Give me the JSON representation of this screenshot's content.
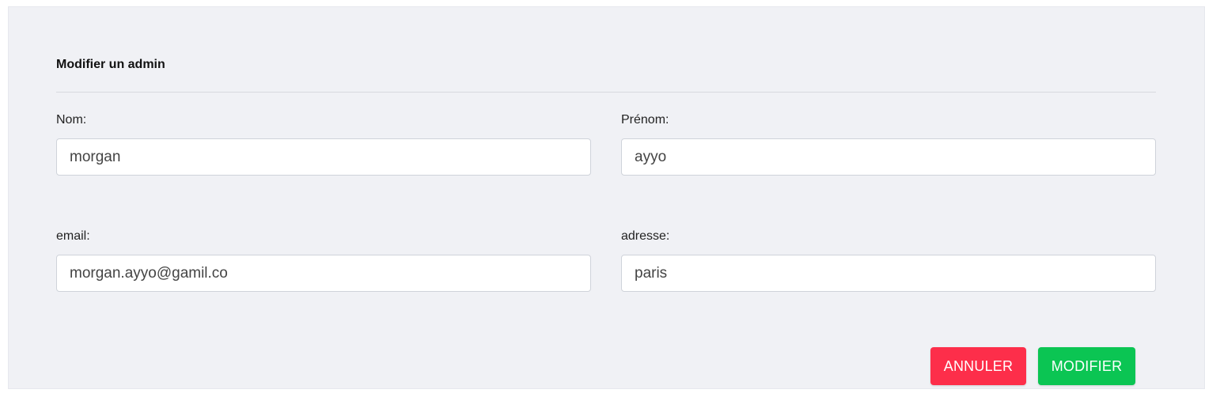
{
  "form": {
    "title": "Modifier un admin",
    "fields": {
      "nom": {
        "label": "Nom:",
        "value": "morgan"
      },
      "prenom": {
        "label": "Prénom:",
        "value": "ayyo"
      },
      "email": {
        "label": "email:",
        "value": "morgan.ayyo@gamil.co"
      },
      "adresse": {
        "label": "adresse:",
        "value": "paris"
      }
    },
    "buttons": {
      "cancel_label": "ANNULER",
      "submit_label": "MODIFIER"
    }
  },
  "colors": {
    "background": "#f0f1f5",
    "cancel": "#fd2e4a",
    "submit": "#0bc553"
  }
}
